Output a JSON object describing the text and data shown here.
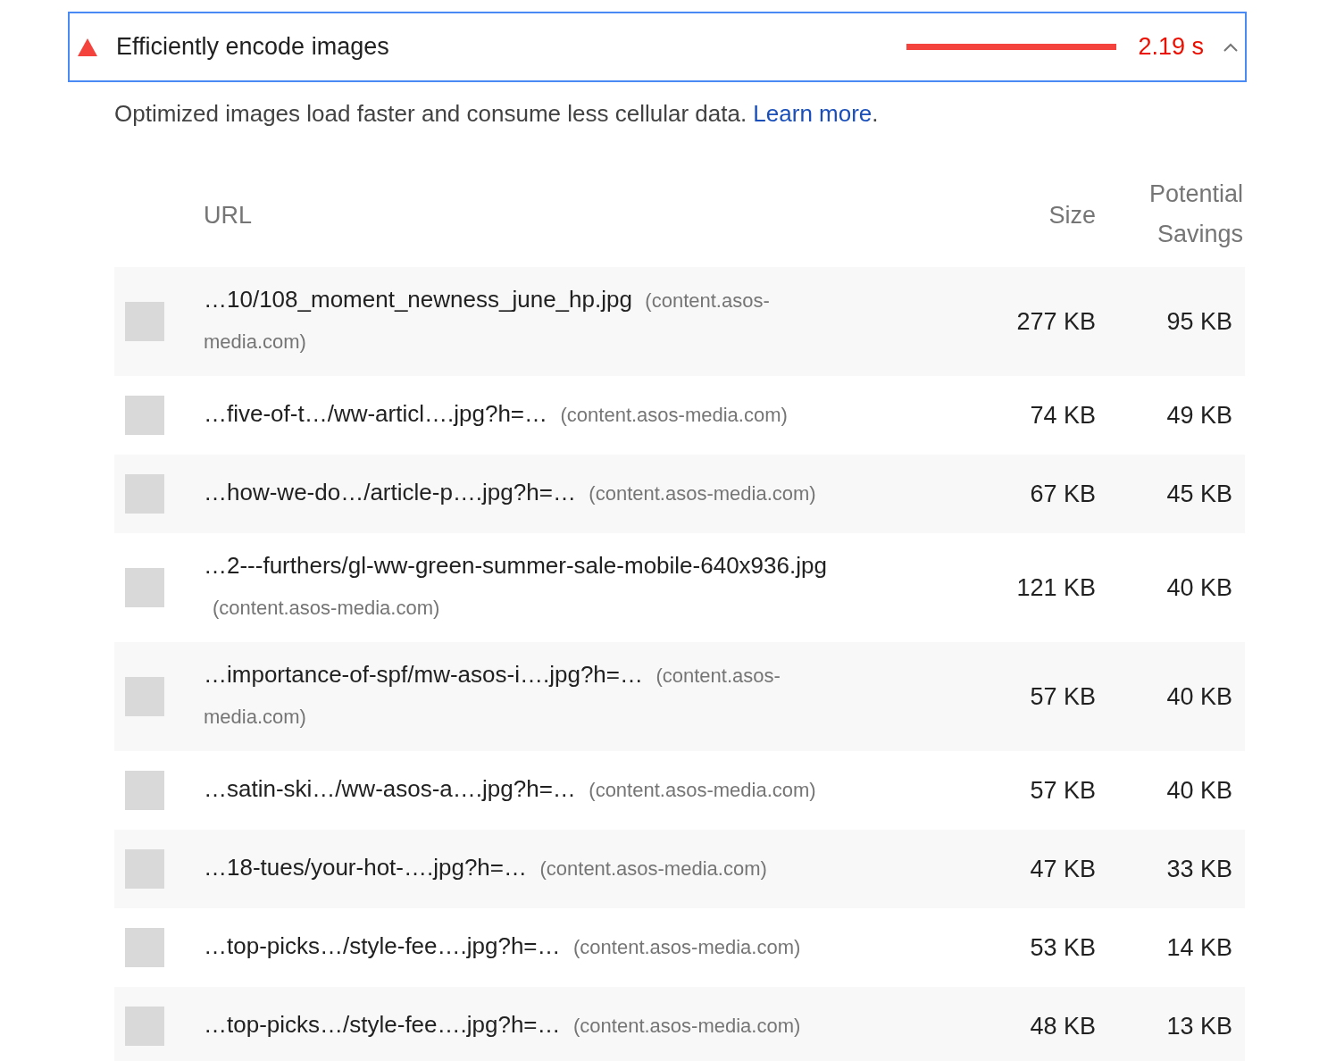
{
  "audit": {
    "title": "Efficiently encode images",
    "savings": "2.19 s",
    "expanded": true,
    "description": "Optimized images load faster and consume less cellular data.",
    "learn_more": "Learn more",
    "description_end": "."
  },
  "table": {
    "columns": [
      "URL",
      "Size",
      "Potential Savings"
    ],
    "rows": [
      {
        "url": "…10/108_moment_newness_june_hp.jpg",
        "host": "(content.asos-media.com)",
        "size": "277 KB",
        "savings": "95 KB"
      },
      {
        "url": "…five-of-t…/ww-articl….jpg?h=…",
        "host": "(content.asos-media.com)",
        "size": "74 KB",
        "savings": "49 KB"
      },
      {
        "url": "…how-we-do…/article-p….jpg?h=…",
        "host": "(content.asos-media.com)",
        "size": "67 KB",
        "savings": "45 KB"
      },
      {
        "url": "…2---furthers/gl-ww-green-summer-sale-mobile-640x936.jpg",
        "host": "(content.asos-media.com)",
        "size": "121 KB",
        "savings": "40 KB"
      },
      {
        "url": "…importance-of-spf/mw-asos-i….jpg?h=…",
        "host": "(content.asos-media.com)",
        "size": "57 KB",
        "savings": "40 KB"
      },
      {
        "url": "…satin-ski…/ww-asos-a….jpg?h=…",
        "host": "(content.asos-media.com)",
        "size": "57 KB",
        "savings": "40 KB"
      },
      {
        "url": "…18-tues/your-hot-….jpg?h=…",
        "host": "(content.asos-media.com)",
        "size": "47 KB",
        "savings": "33 KB"
      },
      {
        "url": "…top-picks…/style-fee….jpg?h=…",
        "host": "(content.asos-media.com)",
        "size": "53 KB",
        "savings": "14 KB"
      },
      {
        "url": "…top-picks…/style-fee….jpg?h=…",
        "host": "(content.asos-media.com)",
        "size": "48 KB",
        "savings": "13 KB"
      }
    ]
  }
}
